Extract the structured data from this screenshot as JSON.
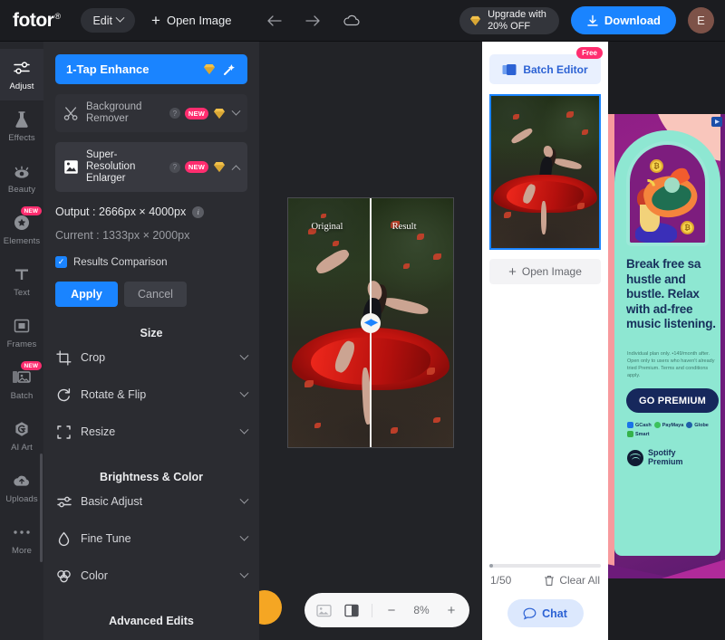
{
  "app": {
    "name": "fotor",
    "trademark": "®"
  },
  "topbar": {
    "edit_label": "Edit",
    "open_image_label": "Open Image",
    "back_icon": "arrow-left-icon",
    "forward_icon": "arrow-right-icon",
    "cloud_icon": "cloud-icon",
    "upgrade_line1": "Upgrade with",
    "upgrade_line2": "20% OFF",
    "download_label": "Download",
    "avatar_initial": "E"
  },
  "rail": {
    "items": [
      {
        "label": "Adjust",
        "icon": "sliders-icon",
        "active": true,
        "badge": ""
      },
      {
        "label": "Effects",
        "icon": "flask-icon",
        "active": false,
        "badge": ""
      },
      {
        "label": "Beauty",
        "icon": "eye-icon",
        "active": false,
        "badge": ""
      },
      {
        "label": "Elements",
        "icon": "star-badge-icon",
        "active": false,
        "badge": "NEW"
      },
      {
        "label": "Text",
        "icon": "text-t-icon",
        "active": false,
        "badge": ""
      },
      {
        "label": "Frames",
        "icon": "frame-icon",
        "active": false,
        "badge": ""
      },
      {
        "label": "Batch",
        "icon": "batch-images-icon",
        "active": false,
        "badge": "NEW"
      },
      {
        "label": "AI Art",
        "icon": "ai-art-icon",
        "active": false,
        "badge": ""
      },
      {
        "label": "Uploads",
        "icon": "upload-cloud-icon",
        "active": false,
        "badge": ""
      },
      {
        "label": "More",
        "icon": "ellipsis-icon",
        "active": false,
        "badge": ""
      }
    ]
  },
  "panel": {
    "enhance_label": "1-Tap Enhance",
    "enhance_diamond_icon": "diamond-icon",
    "enhance_wand_icon": "magic-wand-icon",
    "tools": [
      {
        "name": "Background Remover",
        "icon": "scissors-icon",
        "help": "?",
        "badge": "NEW",
        "diamond": "diamond-icon",
        "expanded": false
      },
      {
        "name": "Super-Resolution Enlarger",
        "icon": "super-resolution-icon",
        "help": "?",
        "badge": "NEW",
        "diamond": "diamond-icon",
        "expanded": true
      }
    ],
    "output_label": "Output : 2666px × 4000px",
    "output_info_icon": "info-icon",
    "current_label": "Current : 1333px × 2000px",
    "results_comparison_label": "Results Comparison",
    "results_comparison_checked": true,
    "apply_label": "Apply",
    "cancel_label": "Cancel",
    "sections": [
      {
        "title": "Size",
        "rows": [
          {
            "label": "Crop",
            "icon": "crop-icon"
          },
          {
            "label": "Rotate & Flip",
            "icon": "rotate-icon"
          },
          {
            "label": "Resize",
            "icon": "resize-icon"
          }
        ]
      },
      {
        "title": "Brightness & Color",
        "rows": [
          {
            "label": "Basic Adjust",
            "icon": "sliders-icon"
          },
          {
            "label": "Fine Tune",
            "icon": "droplet-icon"
          },
          {
            "label": "Color",
            "icon": "color-wheel-icon"
          }
        ]
      }
    ],
    "advanced_title": "Advanced Edits"
  },
  "canvas": {
    "label_original": "Original",
    "label_result": "Result",
    "comparison_handle_icon": "compare-slider-icon",
    "collapse_left_icon": "chevron-left-icon",
    "collapse_right_icon": "chevron-right-icon",
    "zoom": {
      "image_icon": "image-icon",
      "compare_icon": "split-view-icon",
      "minus_label": "−",
      "level": "8%",
      "plus_label": "+"
    }
  },
  "right_panel": {
    "batch_editor_label": "Batch Editor",
    "batch_editor_icon": "batch-layers-icon",
    "free_badge": "Free",
    "open_image_label": "Open Image",
    "count_label": "1/50",
    "clear_all_label": "Clear All",
    "trash_icon": "trash-icon",
    "chat_label": "Chat",
    "chat_icon": "chat-bubble-icon"
  },
  "ad": {
    "headline": "Break free sa hustle and bustle. Relax with ad-free music listening.",
    "fine_print": "Individual plan only. •149/month after. Open only to users who haven't already tried Premium. Terms and conditions apply.",
    "cta_label": "GO PREMIUM",
    "payments": [
      "GCash",
      "PayMaya",
      "Globe",
      "Smart"
    ],
    "brand_line1": "Spotify",
    "brand_line2": "Premium",
    "adchoices_icon": "adchoices-icon"
  },
  "colors": {
    "accent_blue": "#1a84ff",
    "badge_pink": "#ff2d6f",
    "panel_bg": "#2b2c31",
    "rail_bg": "#26272c",
    "topbar_bg": "#1b1c20"
  }
}
